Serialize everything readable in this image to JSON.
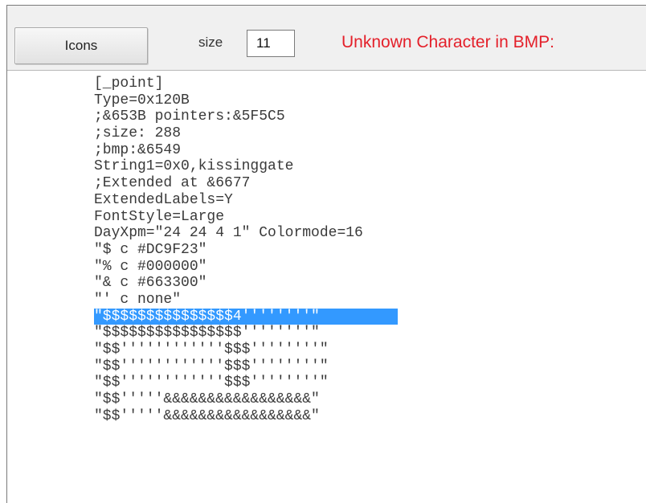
{
  "toolbar": {
    "icons_button_label": "Icons",
    "size_label": "size",
    "size_value": "11",
    "unknown_char_text": "Unknown Character in BMP:"
  },
  "editor": {
    "selected_line_index": 15,
    "lines": [
      "[_point]",
      "Type=0x120B",
      ";&653B pointers:&5F5C5",
      ";size: 288",
      ";bmp:&6549",
      "String1=0x0,kissinggate",
      ";Extended at &6677",
      "ExtendedLabels=Y",
      "FontStyle=Large",
      "DayXpm=\"24 24 4 1\" Colormode=16",
      "\"$ c #DC9F23\"",
      "\"% c #000000\"",
      "\"& c #663300\"",
      "\"' c none\"",
      "\"$$$$$$$$$$$$$$$4''''''''\"",
      "\"$$$$$$$$$$$$$$$$''''''''\"",
      "\"$$''''''''''''$$$''''''''\"",
      "\"$$''''''''''''$$$''''''''\"",
      "\"$$''''''''''''$$$''''''''\"",
      "\"$$'''''&&&&&&&&&&&&&&&&&\"",
      "\"$$'''''&&&&&&&&&&&&&&&&&\""
    ]
  }
}
